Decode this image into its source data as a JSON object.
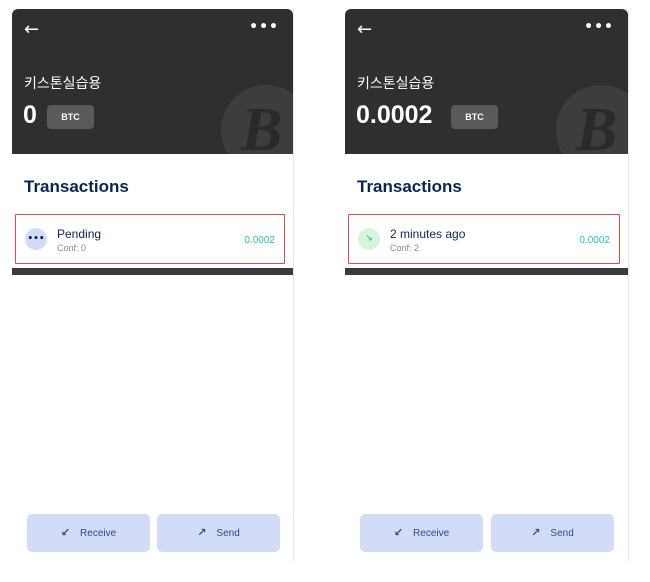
{
  "screens": [
    {
      "back_icon": "arrow-left-icon",
      "more_label": "•••",
      "wallet_name": "키스톤실습용",
      "balance": "0",
      "unit": "BTC",
      "coin_logo": "B",
      "section_title": "Transactions",
      "transaction": {
        "icon": "•••",
        "title": "Pending",
        "subtitle": "Conf: 0",
        "amount": "0.0002"
      },
      "buttons": {
        "receive": "Receive",
        "send": "Send"
      }
    },
    {
      "back_icon": "arrow-left-icon",
      "more_label": "•••",
      "wallet_name": "키스톤실습용",
      "balance": "0.0002",
      "unit": "BTC",
      "coin_logo": "B",
      "section_title": "Transactions",
      "transaction": {
        "icon": "↘",
        "title": "2 minutes ago",
        "subtitle": "Conf: 2",
        "amount": "0.0002"
      },
      "buttons": {
        "receive": "Receive",
        "send": "Send"
      }
    }
  ],
  "colors": {
    "header_bg": "#2f2f2f",
    "title_navy": "#0c2550",
    "amount_green": "#37c0a1",
    "button_bg": "#d2dcf7",
    "highlight_red": "#e24b4b"
  }
}
